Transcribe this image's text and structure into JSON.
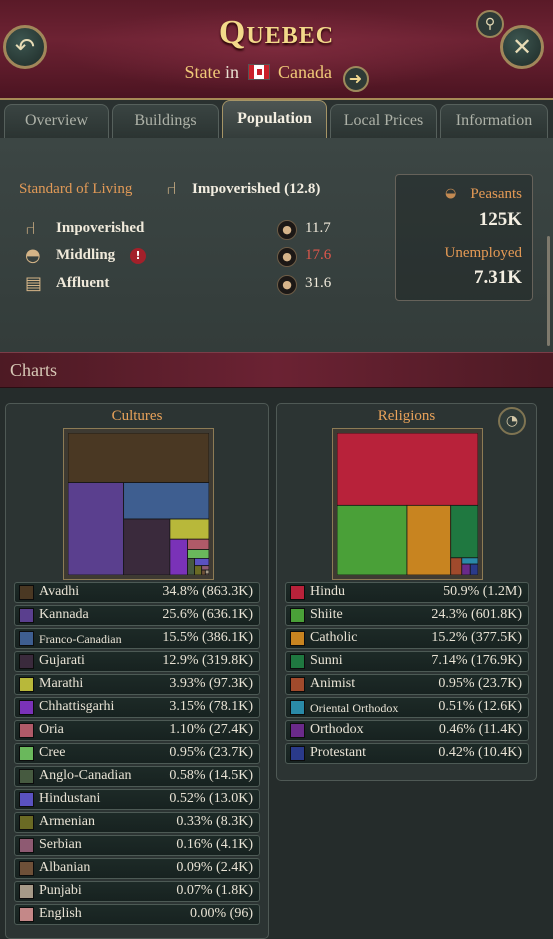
{
  "header": {
    "title": "Quebec",
    "type_label": "State",
    "in_label": "in",
    "country": "Canada"
  },
  "tabs": [
    "Overview",
    "Buildings",
    "Population",
    "Local Prices",
    "Information"
  ],
  "active_tab": "Population",
  "standard_of_living": {
    "label": "Standard of Living",
    "value": "Impoverished (12.8)"
  },
  "strata": [
    {
      "name": "Impoverished",
      "value": "11.7",
      "icon": "chair-icon",
      "warning": false,
      "red": false
    },
    {
      "name": "Middling",
      "value": "17.6",
      "icon": "hat-icon",
      "warning": true,
      "red": true
    },
    {
      "name": "Affluent",
      "value": "31.6",
      "icon": "money-icon",
      "warning": false,
      "red": false
    }
  ],
  "population_box": {
    "peasants_label": "Peasants",
    "peasants_value": "125K",
    "unemployed_label": "Unemployed",
    "unemployed_value": "7.31K"
  },
  "charts_section_title": "Charts",
  "cultures": {
    "title": "Cultures",
    "items": [
      {
        "name": "Avadhi",
        "value": "34.8% (863.3K)",
        "share": 34.8,
        "color": "#4a3823"
      },
      {
        "name": "Kannada",
        "value": "25.6% (636.1K)",
        "share": 25.6,
        "color": "#5a3f8e"
      },
      {
        "name": "Franco-Canadian",
        "value": "15.5% (386.1K)",
        "share": 15.5,
        "color": "#3e5e90"
      },
      {
        "name": "Gujarati",
        "value": "12.9% (319.8K)",
        "share": 12.9,
        "color": "#3a2a3c"
      },
      {
        "name": "Marathi",
        "value": "3.93% (97.3K)",
        "share": 3.93,
        "color": "#b8b83a"
      },
      {
        "name": "Chhattisgarhi",
        "value": "3.15% (78.1K)",
        "share": 3.15,
        "color": "#7a32b8"
      },
      {
        "name": "Oria",
        "value": "1.10% (27.4K)",
        "share": 1.1,
        "color": "#b05a68"
      },
      {
        "name": "Cree",
        "value": "0.95% (23.7K)",
        "share": 0.95,
        "color": "#6ab85c"
      },
      {
        "name": "Anglo-Canadian",
        "value": "0.58% (14.5K)",
        "share": 0.58,
        "color": "#465a40"
      },
      {
        "name": "Hindustani",
        "value": "0.52% (13.0K)",
        "share": 0.52,
        "color": "#5a52c0"
      },
      {
        "name": "Armenian",
        "value": "0.33% (8.3K)",
        "share": 0.33,
        "color": "#6a6a24"
      },
      {
        "name": "Serbian",
        "value": "0.16% (4.1K)",
        "share": 0.16,
        "color": "#8e5a72"
      },
      {
        "name": "Albanian",
        "value": "0.09% (2.4K)",
        "share": 0.09,
        "color": "#6e5038"
      },
      {
        "name": "Punjabi",
        "value": "0.07% (1.8K)",
        "share": 0.07,
        "color": "#a69a88"
      },
      {
        "name": "English",
        "value": "0.00% (96)",
        "share": 0.0,
        "color": "#c48888"
      }
    ]
  },
  "religions": {
    "title": "Religions",
    "items": [
      {
        "name": "Hindu",
        "value": "50.9% (1.2M)",
        "share": 50.9,
        "color": "#b8223a"
      },
      {
        "name": "Shiite",
        "value": "24.3% (601.8K)",
        "share": 24.3,
        "color": "#4aa038"
      },
      {
        "name": "Catholic",
        "value": "15.2% (377.5K)",
        "share": 15.2,
        "color": "#c88420"
      },
      {
        "name": "Sunni",
        "value": "7.14% (176.9K)",
        "share": 7.14,
        "color": "#1f7840"
      },
      {
        "name": "Animist",
        "value": "0.95% (23.7K)",
        "share": 0.95,
        "color": "#a04a2c"
      },
      {
        "name": "Oriental Orthodox",
        "value": "0.51% (12.6K)",
        "share": 0.51,
        "color": "#2a8aa8"
      },
      {
        "name": "Orthodox",
        "value": "0.46% (11.4K)",
        "share": 0.46,
        "color": "#6a2a8a"
      },
      {
        "name": "Protestant",
        "value": "0.42% (10.4K)",
        "share": 0.42,
        "color": "#2a3a8a"
      }
    ]
  }
}
